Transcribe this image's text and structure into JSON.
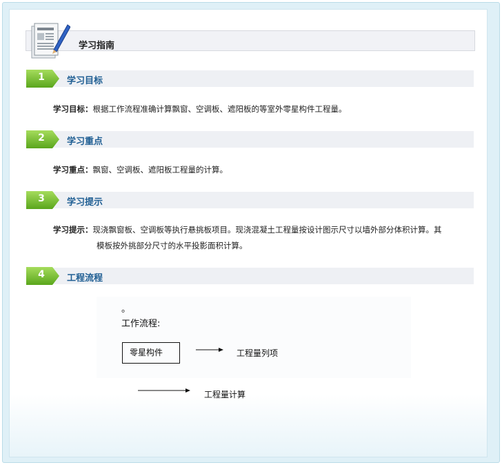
{
  "header": {
    "title": "学习指南",
    "icon": "news-paper-icon"
  },
  "sections": [
    {
      "num": "1",
      "title": "学习目标",
      "label": "学习目标：",
      "text": "根据工作流程准确计算飘窗、空调板、遮阳板的等室外零星构件工程量。"
    },
    {
      "num": "2",
      "title": "学习重点",
      "label": "学习重点：",
      "text": "飘窗、空调板、遮阳板工程量的计算。"
    },
    {
      "num": "3",
      "title": "学习提示",
      "label": "学习提示：",
      "text_line1": "现浇飘窗板、空调板等执行悬挑板项目。现浇混凝土工程量按设计图示尺寸以墙外部分体积计算。其",
      "text_line2": "模板按外挑部分尺寸的水平投影面积计算。"
    },
    {
      "num": "4",
      "title": "工程流程"
    }
  ],
  "flow": {
    "dot": "。",
    "title": "工作流程:",
    "box_label": "零星构件",
    "step2": "工程量列项",
    "step3": "工程量计算"
  },
  "colors": {
    "accent_green": "#6fbf2a",
    "section_title": "#1f5e93",
    "frame": "#dff0f7"
  }
}
